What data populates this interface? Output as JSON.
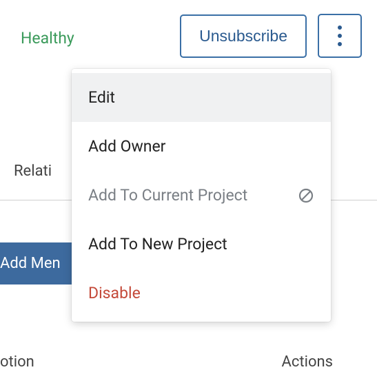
{
  "status": {
    "health_label": "Healthy"
  },
  "toolbar": {
    "unsubscribe_label": "Unsubscribe"
  },
  "tabs": {
    "relations_partial": "Relati"
  },
  "buttons": {
    "add_member_partial": "Add Men"
  },
  "columns": {
    "col_a_partial": "otion",
    "col_b_partial": "Actions"
  },
  "dropdown": {
    "items": [
      {
        "label": "Edit",
        "highlighted": true,
        "enabled": true,
        "danger": false
      },
      {
        "label": "Add Owner",
        "highlighted": false,
        "enabled": true,
        "danger": false
      },
      {
        "label": "Add To Current Project",
        "highlighted": false,
        "enabled": false,
        "danger": false
      },
      {
        "label": "Add To New Project",
        "highlighted": false,
        "enabled": true,
        "danger": false
      },
      {
        "label": "Disable",
        "highlighted": false,
        "enabled": true,
        "danger": true
      }
    ]
  }
}
